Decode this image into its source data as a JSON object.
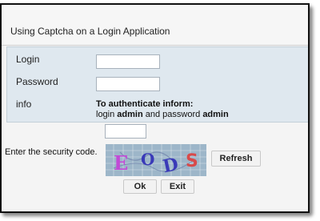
{
  "window": {
    "title": "Using Captcha on a Login Application"
  },
  "form": {
    "login_label": "Login",
    "password_label": "Password",
    "info_label": "info",
    "login_value": "",
    "password_value": "",
    "info_heading": "To authenticate inform:",
    "info_line_prefix": "login ",
    "info_user": "admin",
    "info_line_middle": " and password ",
    "info_pass": "admin"
  },
  "captcha": {
    "label": "Enter the security code.",
    "input_value": "",
    "characters": [
      "E",
      "O",
      "D",
      "S"
    ],
    "refresh_label": "Refresh"
  },
  "buttons": {
    "ok_label": "Ok",
    "exit_label": "Exit"
  },
  "colors": {
    "form_panel": "#dfe8ef",
    "captcha_bg": "#9db6c9",
    "captcha_chars": [
      "#c24ad6",
      "#3a3ab8",
      "#3a3ab8",
      "#d84a4a"
    ]
  }
}
